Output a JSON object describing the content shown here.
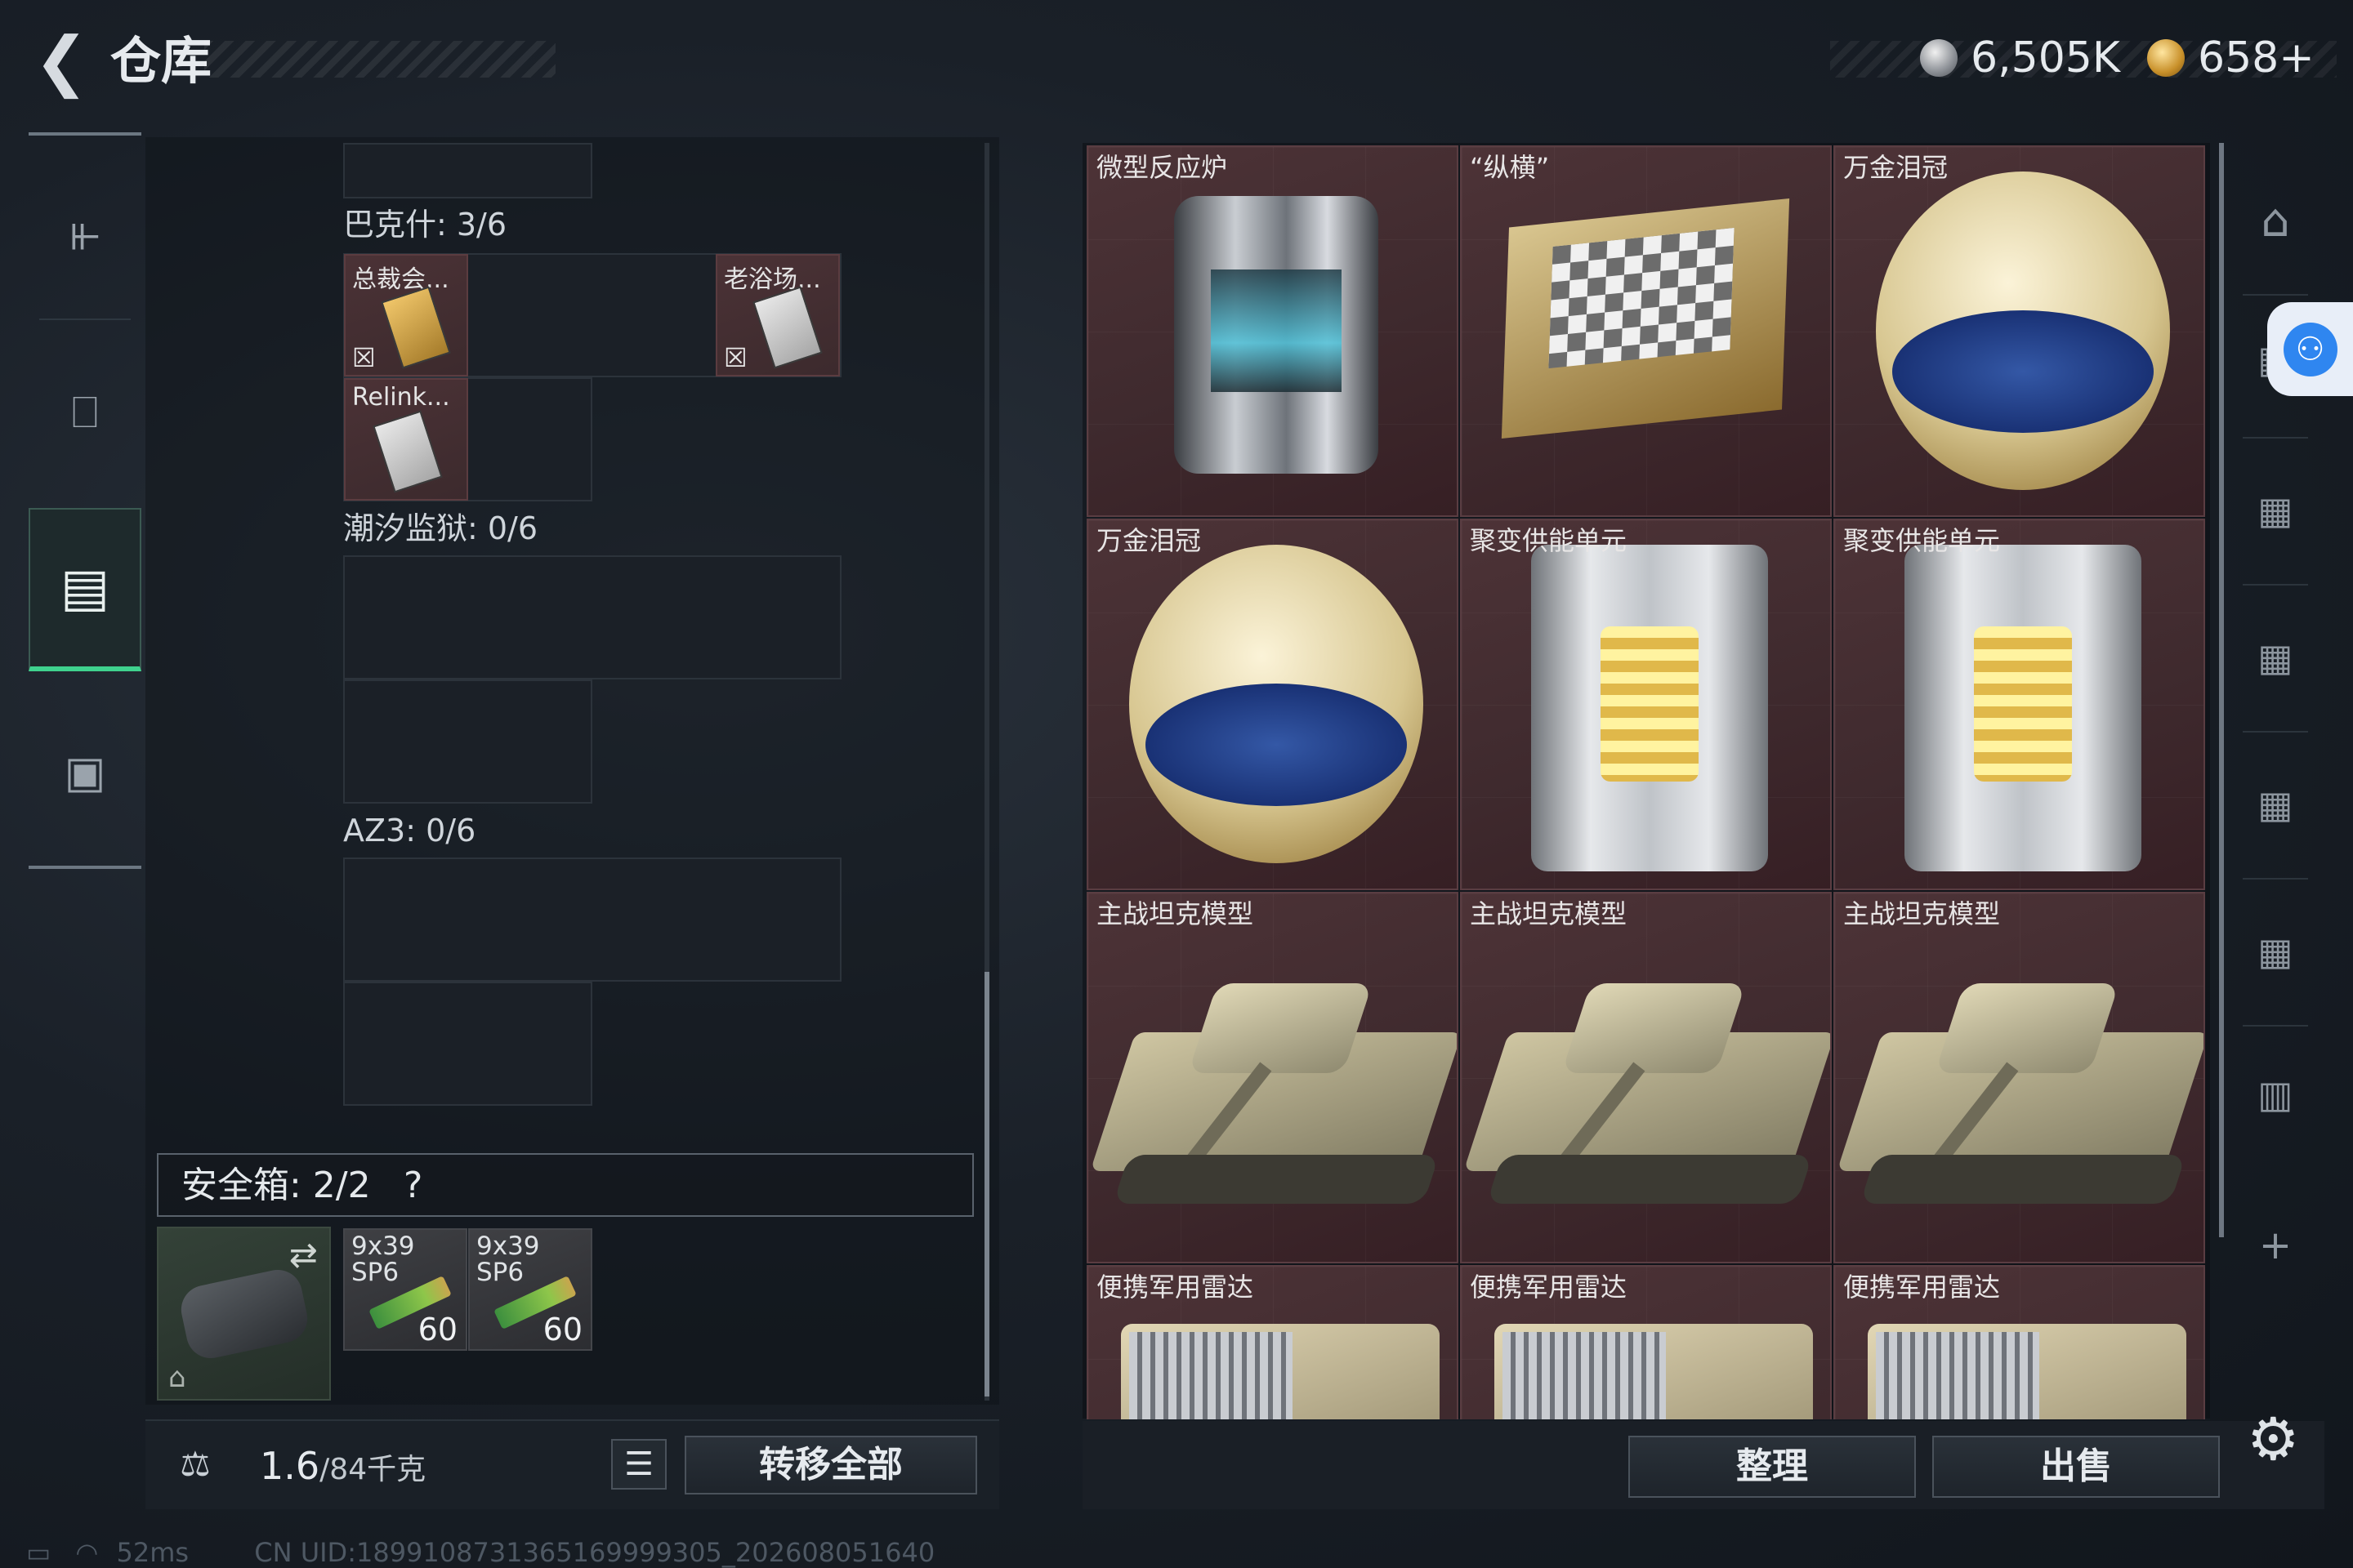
{
  "header": {
    "title": "仓库",
    "back_icon": "chevron-left-icon"
  },
  "currency": [
    {
      "icon": "silver-coin-icon",
      "value": "6,505K"
    },
    {
      "icon": "gold-coin-icon",
      "value": "658+"
    }
  ],
  "left_tabs": [
    {
      "icon": "gun-icon",
      "active": false
    },
    {
      "icon": "backpack-icon",
      "active": false
    },
    {
      "icon": "vest-icon",
      "active": true
    },
    {
      "icon": "briefcase-icon",
      "active": false
    }
  ],
  "sections": [
    {
      "label": "巴克什: 3/6",
      "items": [
        {
          "name": "总裁会...",
          "icon": "keycard-icon"
        },
        {
          "name": "老浴场...",
          "icon": "keycard-icon"
        },
        {
          "name": "Relink...",
          "icon": "keycard-icon"
        }
      ]
    },
    {
      "label": "潮汐监狱: 0/6"
    },
    {
      "label": "AZ3: 0/6"
    }
  ],
  "safe_box": {
    "label": "安全箱: 2/2",
    "help": "?",
    "ammo": [
      {
        "name": "9x39\nSP6",
        "count": "60"
      },
      {
        "name": "9x39\nSP6",
        "count": "60"
      }
    ]
  },
  "footer_left": {
    "weight": "1.6",
    "weight_max": "/84千克",
    "transfer_all": "转移全部"
  },
  "grid_items": [
    {
      "name": "微型反应炉",
      "kind": "reactor"
    },
    {
      "name": "“纵横”",
      "kind": "chess"
    },
    {
      "name": "万金泪冠",
      "kind": "egg"
    },
    {
      "name": "万金泪冠",
      "kind": "egg"
    },
    {
      "name": "聚变供能单元",
      "kind": "fusion"
    },
    {
      "name": "聚变供能单元",
      "kind": "fusion"
    },
    {
      "name": "主战坦克模型",
      "kind": "tank"
    },
    {
      "name": "主战坦克模型",
      "kind": "tank"
    },
    {
      "name": "主战坦克模型",
      "kind": "tank"
    },
    {
      "name": "便携军用雷达",
      "kind": "radar"
    },
    {
      "name": "便携军用雷达",
      "kind": "radar"
    },
    {
      "name": "便携军用雷达",
      "kind": "radar"
    }
  ],
  "footer_right": {
    "sort": "整理",
    "sell": "出售"
  },
  "status_bar": {
    "ping": "52ms",
    "uid": "CN UID:1899108731365169999305_202608051640"
  }
}
